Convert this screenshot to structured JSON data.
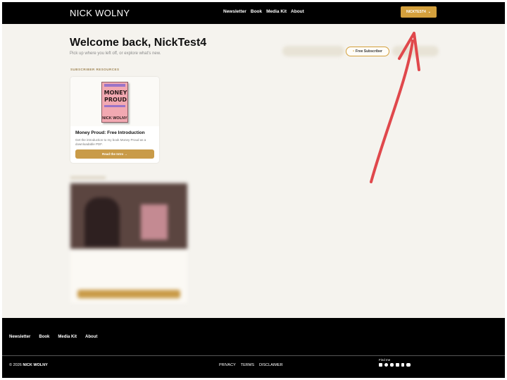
{
  "header": {
    "brand": "NICK WOLNY",
    "nav": [
      "Newsletter",
      "Book",
      "Media Kit",
      "About"
    ],
    "user_button": "NICKTEST4",
    "user_chevron": "⌵"
  },
  "welcome": {
    "title": "Welcome back, NickTest4",
    "subtitle": "Pick up where you left off, or explore what's new.",
    "badge_dot": "•",
    "badge_label": "Free Subscriber"
  },
  "resources": {
    "section_label": "SUBSCRIBER RESOURCES",
    "card": {
      "book_title_line1": "MONEY",
      "book_title_line2": "PROUD",
      "book_author": "NICK WOLNY",
      "title": "Money Proud: Free Introduction",
      "description": "Get the introduction to my book Money Proud as a downloadable PDF.",
      "button": "Read the Intro →"
    }
  },
  "footer": {
    "nav": [
      "Newsletter",
      "Book",
      "Media Kit",
      "About"
    ],
    "copyright_prefix": "© 2026 ",
    "copyright_name": "NICK WOLNY",
    "legal": [
      "PRIVACY",
      "TERMS",
      "DISCLAIMER"
    ],
    "find_me": "Find me",
    "socials": [
      "linkedin-icon",
      "facebook-icon",
      "instagram-icon",
      "substack-icon",
      "tiktok-icon",
      "youtube-icon"
    ]
  },
  "colors": {
    "accent": "#d4a03c",
    "background": "#f5f3ee",
    "header": "#000000",
    "annotation": "#e0484c"
  }
}
